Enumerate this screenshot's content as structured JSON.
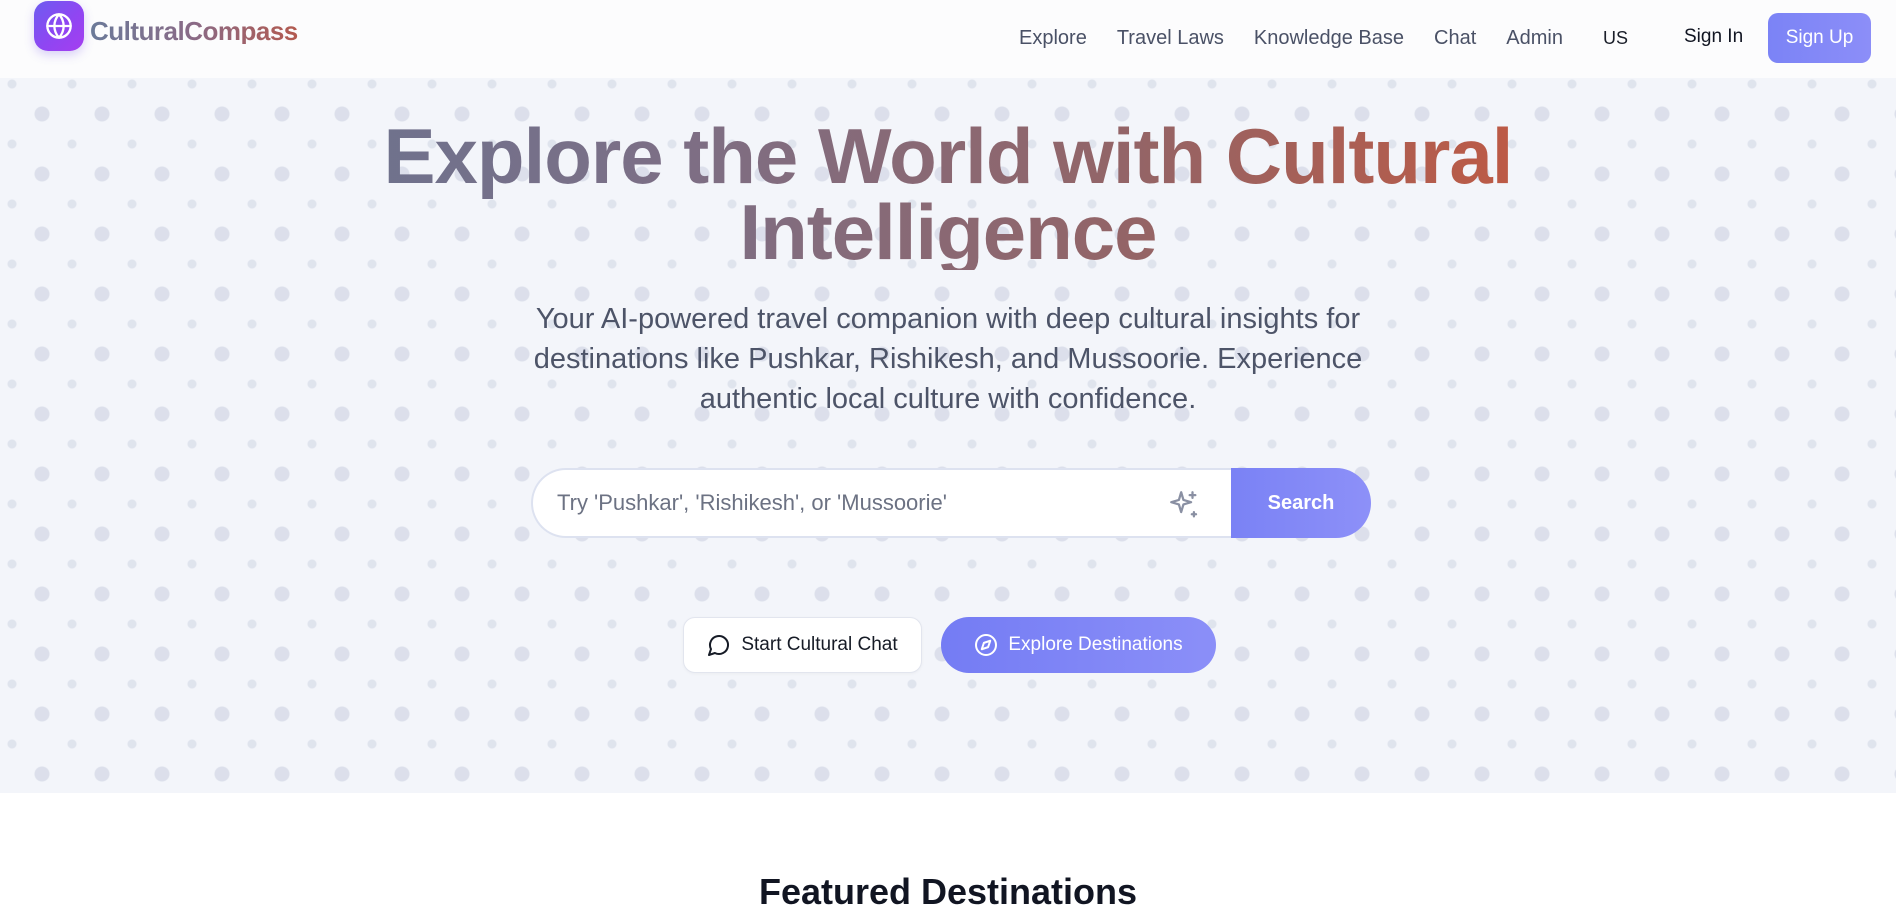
{
  "brand": {
    "name": "CulturalCompass",
    "logo_icon": "globe-icon"
  },
  "nav": {
    "links": [
      "Explore",
      "Travel Laws",
      "Knowledge Base",
      "Chat",
      "Admin"
    ],
    "language": "US",
    "sign_in": "Sign In",
    "sign_up": "Sign Up"
  },
  "hero": {
    "title_line1": "Explore the World with Cultural",
    "title_line2": "Intelligence",
    "subtitle": "Your AI-powered travel companion with deep cultural insights for destinations like Pushkar, Rishikesh, and Mussoorie. Experience authentic local culture with confidence.",
    "search": {
      "placeholder": "Try 'Pushkar', 'Rishikesh', or 'Mussoorie'",
      "value": "",
      "button": "Search",
      "icon": "sparkles-icon"
    },
    "chat_button": {
      "label": "Start Cultural Chat",
      "icon": "message-circle-icon"
    },
    "explore_button": {
      "label": "Explore Destinations",
      "icon": "compass-icon"
    }
  },
  "featured": {
    "title": "Featured Destinations"
  },
  "colors": {
    "accent": "#7b83f6",
    "logo_gradient_start": "#6d5cf0",
    "logo_gradient_end": "#a53ef0",
    "title_gradient_start": "#5f7595",
    "title_gradient_end": "#c0573f",
    "hero_background": "#f3f5fa"
  }
}
